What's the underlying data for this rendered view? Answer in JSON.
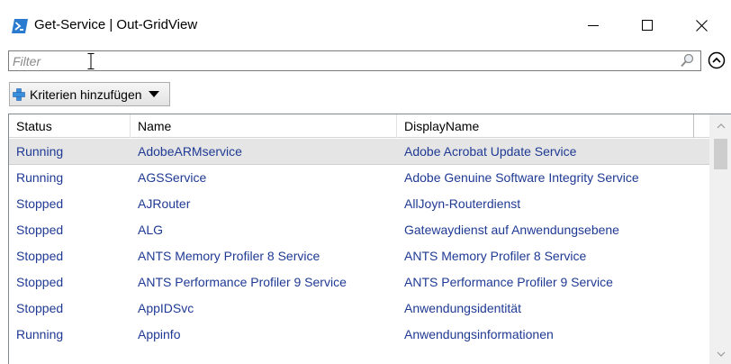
{
  "window": {
    "title": "Get-Service | Out-GridView"
  },
  "filter": {
    "placeholder": "Filter",
    "value": ""
  },
  "criteria_button": {
    "label": "Kriterien hinzufügen"
  },
  "grid": {
    "columns": [
      "Status",
      "Name",
      "DisplayName"
    ],
    "rows": [
      {
        "status": "Running",
        "name": "AdobeARMservice",
        "display_name": "Adobe Acrobat Update Service",
        "selected": true
      },
      {
        "status": "Running",
        "name": "AGSService",
        "display_name": "Adobe Genuine Software Integrity Service"
      },
      {
        "status": "Stopped",
        "name": "AJRouter",
        "display_name": "AllJoyn-Routerdienst"
      },
      {
        "status": "Stopped",
        "name": "ALG",
        "display_name": "Gatewaydienst auf Anwendungsebene"
      },
      {
        "status": "Stopped",
        "name": "ANTS Memory Profiler 8 Service",
        "display_name": "ANTS Memory Profiler 8 Service"
      },
      {
        "status": "Stopped",
        "name": "ANTS Performance Profiler 9 Service",
        "display_name": "ANTS Performance Profiler 9 Service"
      },
      {
        "status": "Stopped",
        "name": "AppIDSvc",
        "display_name": "Anwendungsidentität"
      },
      {
        "status": "Running",
        "name": "Appinfo",
        "display_name": "Anwendungsinformationen"
      }
    ]
  },
  "colors": {
    "cell_text": "#1f3a94",
    "selected_row": "#e5e5e5",
    "powershell_icon": "#2a7bd0"
  },
  "icons": {
    "app": "powershell-icon",
    "minimize": "minimize-icon",
    "maximize": "maximize-icon",
    "close": "close-icon",
    "search": "search-icon",
    "collapse": "chevron-up-icon",
    "add": "plus-icon",
    "dropdown": "caret-down-icon"
  }
}
